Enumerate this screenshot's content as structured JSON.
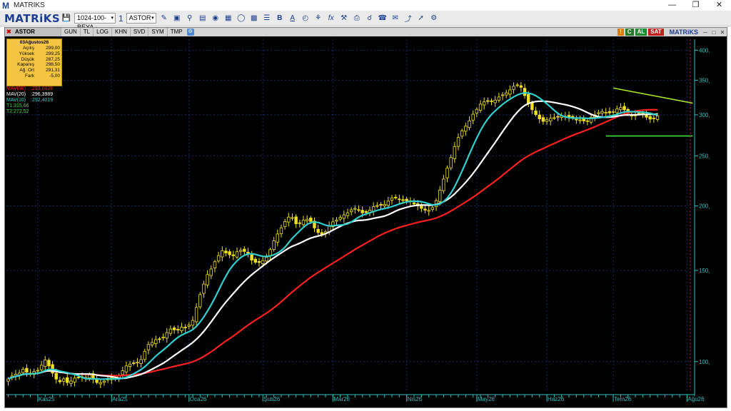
{
  "window": {
    "title": "MATRIKS",
    "app_icon": "M"
  },
  "toolbar": {
    "logo": "MATRiKS",
    "layout_select": "1024-100-BEYA",
    "chart_count": "1",
    "symbol_select": "ASTOR",
    "icons": [
      "save-icon",
      "pencil-icon",
      "window-icon",
      "zoom-icon",
      "chart-type-icon",
      "palette-icon",
      "circle-icon",
      "grid-icon",
      "table-icon",
      "indicator-icon",
      "bold-icon",
      "underline-icon",
      "time-icon",
      "scanner-icon",
      "fx-icon",
      "tools-icon",
      "print-icon",
      "search-icon",
      "alarm-icon",
      "news-icon",
      "settings-icon"
    ]
  },
  "chart_tabs": {
    "symbol": "ASTOR",
    "tabs": [
      "GUN",
      "TL",
      "LOG",
      "KHN",
      "SVD",
      "SYM",
      "TMP"
    ],
    "badges": [
      "AL",
      "SAT"
    ],
    "brand": "MATRiKS"
  },
  "info_box": {
    "date": "03Ağustos26",
    "rows": [
      {
        "k": "Açılış",
        "v": "299,00"
      },
      {
        "k": "Yüksek",
        "v": "299,25"
      },
      {
        "k": "Düşük",
        "v": "287,25"
      },
      {
        "k": "Kapanış",
        "v": "298,50"
      },
      {
        "k": "Ağ. Ort",
        "v": "291,31"
      },
      {
        "k": "Fark",
        "v": "-5,00"
      }
    ]
  },
  "indicators": [
    {
      "name": "MAV(50)",
      "value": ":293,0026",
      "color": "#ff2020"
    },
    {
      "name": "MAV(20)",
      "value": ":296,3989",
      "color": "#ffffff"
    },
    {
      "name": "MAV(10)",
      "value": ":292,4019",
      "color": "#30d0d0"
    },
    {
      "name": "T1:315,66",
      "value": "",
      "color": "#40e040"
    },
    {
      "name": "T2:272,52",
      "value": "",
      "color": "#40e040"
    }
  ],
  "chart_data": {
    "type": "candlestick",
    "scale": "log",
    "ylim": [
      88,
      420
    ],
    "y_ticks": [
      {
        "v": 400,
        "label": "400,"
      },
      {
        "v": 350,
        "label": "350,"
      },
      {
        "v": 300,
        "label": "300,"
      },
      {
        "v": 250,
        "label": "250,"
      },
      {
        "v": 200,
        "label": "200,"
      },
      {
        "v": 150,
        "label": "150,"
      },
      {
        "v": 100,
        "label": "100,"
      }
    ],
    "x_labels": [
      "Kas25",
      "Ara25",
      "Oca26",
      "Şub26",
      "Mar26",
      "Nis26",
      "May26",
      "Haz26",
      "Tem26",
      "Ağu26"
    ],
    "x_label_index": [
      8,
      28,
      49,
      69,
      88,
      108,
      127,
      146,
      164,
      184
    ],
    "n_bars": 185,
    "closes": [
      92.6,
      93.8,
      94.5,
      95.0,
      96.6,
      95.4,
      94.8,
      95.7,
      96.2,
      98.4,
      100.7,
      98.1,
      95.0,
      92.5,
      91.4,
      92.6,
      91.1,
      91.7,
      92.9,
      93.2,
      93.3,
      93.2,
      94.2,
      92.6,
      91.1,
      91.1,
      91.7,
      92.5,
      93.0,
      92.7,
      94.0,
      96.0,
      98.1,
      98.9,
      99.3,
      99.7,
      100.9,
      104.7,
      107.9,
      108.9,
      110.3,
      110.6,
      111.5,
      113.8,
      115.6,
      115.2,
      115.4,
      116.6,
      116.3,
      117.7,
      120.1,
      127.3,
      134.8,
      141.2,
      147.3,
      151.0,
      156.0,
      160.3,
      163.8,
      162.2,
      160.9,
      160.2,
      163.1,
      164.1,
      163.3,
      161.5,
      157.1,
      155.6,
      155.5,
      156.8,
      159.1,
      164.6,
      171.2,
      176.5,
      181.4,
      186.6,
      190.3,
      189.8,
      184.7,
      184.9,
      187.7,
      188.5,
      186.6,
      181.3,
      177.6,
      176.2,
      178.2,
      183.3,
      186.3,
      187.7,
      190.0,
      192.2,
      193.9,
      196.6,
      197.8,
      196.4,
      193.9,
      194.2,
      196.3,
      199.3,
      200.3,
      200.7,
      201.4,
      204.3,
      207.2,
      207.4,
      206.0,
      204.9,
      204.6,
      203.9,
      201.7,
      200.0,
      197.8,
      196.3,
      196.1,
      198.5,
      204.8,
      214.6,
      225.4,
      236.6,
      248.1,
      260.6,
      271.2,
      279.4,
      285.1,
      292.1,
      300.8,
      307.4,
      314.6,
      317.8,
      318.5,
      318.5,
      320.3,
      324.8,
      327.9,
      330.9,
      335.2,
      340.6,
      342.8,
      339.1,
      326.9,
      315.6,
      307.0,
      300.3,
      294.6,
      291.4,
      293.6,
      295.4,
      296.2,
      297.4,
      298.3,
      298.1,
      296.8,
      295.7,
      293.7,
      293.2,
      291.9,
      292.1,
      296.8,
      299.9,
      302.8,
      304.5,
      303.4,
      302.6,
      304.3,
      307.9,
      309.8,
      306.8,
      302.0,
      298.4,
      300.4,
      302.3,
      302.0,
      296.8,
      294.3,
      295.1,
      298.5
    ],
    "series": [
      {
        "name": "MAV(10)",
        "color": "#30d0d0"
      },
      {
        "name": "MAV(20)",
        "color": "#ffffff"
      },
      {
        "name": "MAV(50)",
        "color": "#ff2020"
      }
    ],
    "trendlines": [
      {
        "name": "T1",
        "label": "T1:315,66",
        "from": [
          164,
          338
        ],
        "to": [
          184,
          316
        ],
        "color": "#a8e02a"
      },
      {
        "name": "T2",
        "label": "T2:272,52",
        "from": [
          162,
          273
        ],
        "to": [
          184,
          273
        ],
        "color": "#40e040"
      }
    ],
    "grid": true
  }
}
